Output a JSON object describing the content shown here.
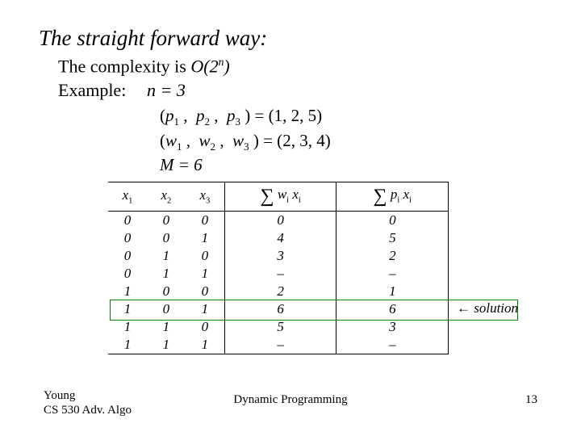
{
  "heading": "The straight forward way:",
  "complexity_prefix": "The complexity is ",
  "complexity_O": "O(2",
  "complexity_exp": "n",
  "complexity_close": ")",
  "example_label": "Example:",
  "math": {
    "n_eq": "n = 3",
    "p_tuple_left": "p",
    "w_tuple_left": "w",
    "p_values": "1,   2,   5",
    "w_values": "2,   3,   4",
    "M_eq": "M = 6"
  },
  "table": {
    "headers": {
      "x1": "x",
      "x2": "x",
      "x3": "x",
      "sw": "w",
      "sp": "p"
    },
    "subs": {
      "x1": "1",
      "x2": "2",
      "x3": "3",
      "i": "i"
    },
    "rows": [
      {
        "x1": "0",
        "x2": "0",
        "x3": "0",
        "sw": "0",
        "sp": "0"
      },
      {
        "x1": "0",
        "x2": "0",
        "x3": "1",
        "sw": "4",
        "sp": "5"
      },
      {
        "x1": "0",
        "x2": "1",
        "x3": "0",
        "sw": "3",
        "sp": "2"
      },
      {
        "x1": "0",
        "x2": "1",
        "x3": "1",
        "sw": "–",
        "sp": "–"
      },
      {
        "x1": "1",
        "x2": "0",
        "x3": "0",
        "sw": "2",
        "sp": "1"
      },
      {
        "x1": "1",
        "x2": "0",
        "x3": "1",
        "sw": "6",
        "sp": "6"
      },
      {
        "x1": "1",
        "x2": "1",
        "x3": "0",
        "sw": "5",
        "sp": "3"
      },
      {
        "x1": "1",
        "x2": "1",
        "x3": "1",
        "sw": "–",
        "sp": "–"
      }
    ],
    "solution_label": "← solution"
  },
  "chart_data": {
    "type": "table",
    "title": "Brute-force enumeration for 0/1 knapsack, n=3, M=6, p=(1,2,5), w=(2,3,4)",
    "columns": [
      "x1",
      "x2",
      "x3",
      "Σ w_i x_i",
      "Σ p_i x_i"
    ],
    "rows": [
      [
        0,
        0,
        0,
        0,
        0
      ],
      [
        0,
        0,
        1,
        4,
        5
      ],
      [
        0,
        1,
        0,
        3,
        2
      ],
      [
        0,
        1,
        1,
        null,
        null
      ],
      [
        1,
        0,
        0,
        2,
        1
      ],
      [
        1,
        0,
        1,
        6,
        6
      ],
      [
        1,
        1,
        0,
        5,
        3
      ],
      [
        1,
        1,
        1,
        null,
        null
      ]
    ],
    "solution_row_index": 5
  },
  "footer": {
    "left1": "Young",
    "left2": "CS 530 Adv. Algo",
    "center": "Dynamic Programming",
    "page": "13"
  }
}
